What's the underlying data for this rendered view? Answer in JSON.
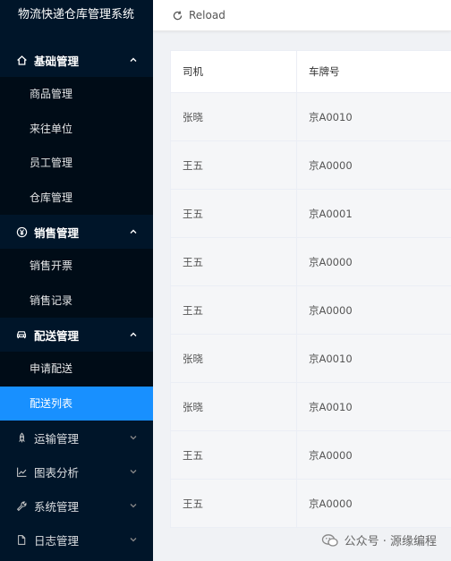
{
  "app": {
    "title": "物流快递仓库管理系统"
  },
  "sidebar": {
    "groups": [
      {
        "label": "基础管理",
        "icon": "home-icon",
        "expanded": true,
        "items": [
          "商品管理",
          "来往单位",
          "员工管理",
          "仓库管理"
        ]
      },
      {
        "label": "销售管理",
        "icon": "yen-icon",
        "expanded": true,
        "items": [
          "销售开票",
          "销售记录"
        ]
      },
      {
        "label": "配送管理",
        "icon": "car-icon",
        "expanded": true,
        "items": [
          "申请配送",
          "配送列表"
        ],
        "active_item": "配送列表"
      },
      {
        "label": "运输管理",
        "icon": "rocket-icon",
        "expanded": false
      },
      {
        "label": "图表分析",
        "icon": "line-chart-icon",
        "expanded": false
      },
      {
        "label": "系统管理",
        "icon": "wrench-icon",
        "expanded": false
      },
      {
        "label": "日志管理",
        "icon": "file-icon",
        "expanded": false
      }
    ]
  },
  "topbar": {
    "reload_label": "Reload"
  },
  "table": {
    "headers": [
      "司机",
      "车牌号"
    ],
    "rows": [
      [
        "张晓",
        "京A0010"
      ],
      [
        "王五",
        "京A0000"
      ],
      [
        "王五",
        "京A0001"
      ],
      [
        "王五",
        "京A0000"
      ],
      [
        "王五",
        "京A0000"
      ],
      [
        "张晓",
        "京A0010"
      ],
      [
        "张晓",
        "京A0010"
      ],
      [
        "王五",
        "京A0000"
      ],
      [
        "王五",
        "京A0000"
      ]
    ]
  },
  "watermark": {
    "text": "公众号 · 源缘编程"
  },
  "colors": {
    "sidebar_bg": "#001529",
    "submenu_bg": "#000c17",
    "active": "#1890ff"
  }
}
